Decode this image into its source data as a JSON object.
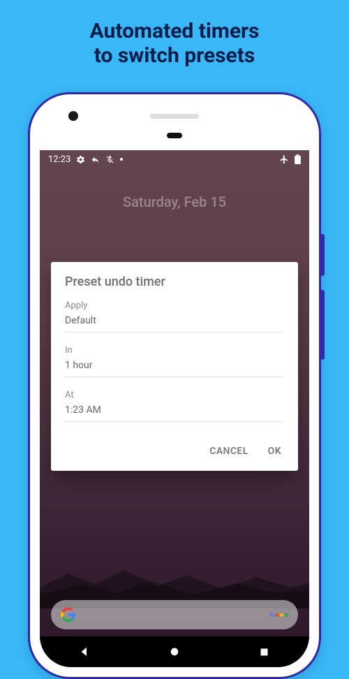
{
  "headline": "Automated timers\nto switch presets",
  "status": {
    "time": "12:23",
    "icons_left": [
      "gear-icon",
      "reply-icon",
      "mic-off-icon",
      "dot-icon"
    ],
    "icons_right": [
      "airplane-icon",
      "battery-icon"
    ]
  },
  "wallpaper_date": "Saturday, Feb 15",
  "dialog": {
    "title": "Preset undo timer",
    "fields": [
      {
        "label": "Apply",
        "value": "Default"
      },
      {
        "label": "In",
        "value": "1 hour"
      },
      {
        "label": "At",
        "value": "1:23 AM"
      }
    ],
    "cancel": "CANCEL",
    "ok": "OK"
  },
  "search": {
    "left_icon": "google-g",
    "right_icon": "assistant-icon"
  },
  "navbar": {
    "buttons": [
      "back",
      "home",
      "recent"
    ]
  }
}
